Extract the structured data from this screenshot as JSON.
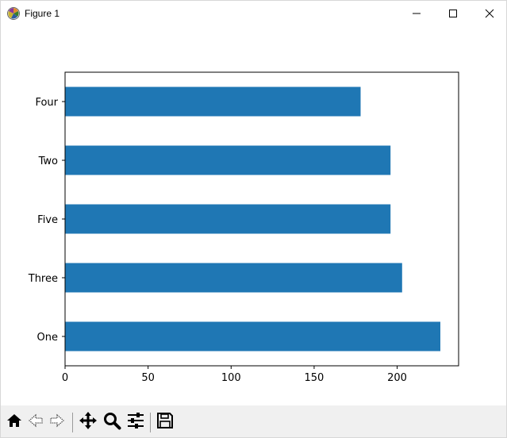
{
  "window": {
    "title": "Figure 1"
  },
  "titlebar_buttons": [
    "minimize-icon",
    "maximize-icon",
    "close-icon"
  ],
  "toolbar": {
    "tools": [
      "home-icon",
      "back-icon",
      "forward-icon",
      "pan-icon",
      "zoom-icon",
      "configure-subplots-icon",
      "save-icon"
    ]
  },
  "colors": {
    "bar": "#1f77b4",
    "toolbar_bg": "#f0f0f0"
  },
  "chart_data": {
    "type": "bar",
    "orientation": "horizontal",
    "categories": [
      "One",
      "Three",
      "Five",
      "Two",
      "Four"
    ],
    "values": [
      226,
      203,
      196,
      196,
      178
    ],
    "xlim": [
      0,
      237
    ],
    "xticks": [
      0,
      50,
      100,
      150,
      200
    ],
    "xtick_labels": [
      "0",
      "50",
      "100",
      "150",
      "200"
    ],
    "grid": false,
    "legend": false
  }
}
